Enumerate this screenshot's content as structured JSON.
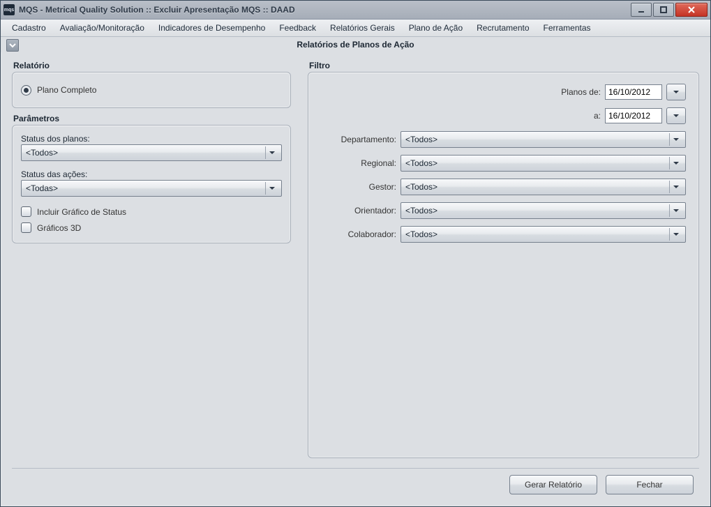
{
  "app_icon_text": "mqs",
  "window_title": "MQS - Metrical Quality Solution :: Excluir Apresentação MQS :: DAAD",
  "menu": {
    "cadastro": "Cadastro",
    "avaliacao": "Avaliação/Monitoração",
    "indicadores": "Indicadores de Desempenho",
    "feedback": "Feedback",
    "relatorios_gerais": "Relatórios Gerais",
    "plano_acao": "Plano de Ação",
    "recrutamento": "Recrutamento",
    "ferramentas": "Ferramentas"
  },
  "page_title": "Relatórios de Planos de Ação",
  "relatorio": {
    "group_label": "Relatório",
    "option_plano_completo": "Plano Completo"
  },
  "parametros": {
    "group_label": "Parâmetros",
    "status_planos_label": "Status dos planos:",
    "status_planos_value": "<Todos>",
    "status_acoes_label": "Status das ações:",
    "status_acoes_value": "<Todas>",
    "incluir_grafico_label": "Incluir Gráfico de Status",
    "graficos_3d_label": "Gráficos 3D"
  },
  "filtro": {
    "group_label": "Filtro",
    "planos_de_label": "Planos de:",
    "planos_de_value": "16/10/2012",
    "a_label": "a:",
    "a_value": "16/10/2012",
    "departamento_label": "Departamento:",
    "departamento_value": "<Todos>",
    "regional_label": "Regional:",
    "regional_value": "<Todos>",
    "gestor_label": "Gestor:",
    "gestor_value": "<Todos>",
    "orientador_label": "Orientador:",
    "orientador_value": "<Todos>",
    "colaborador_label": "Colaborador:",
    "colaborador_value": "<Todos>"
  },
  "footer": {
    "gerar_relatorio": "Gerar Relatório",
    "fechar": "Fechar"
  }
}
